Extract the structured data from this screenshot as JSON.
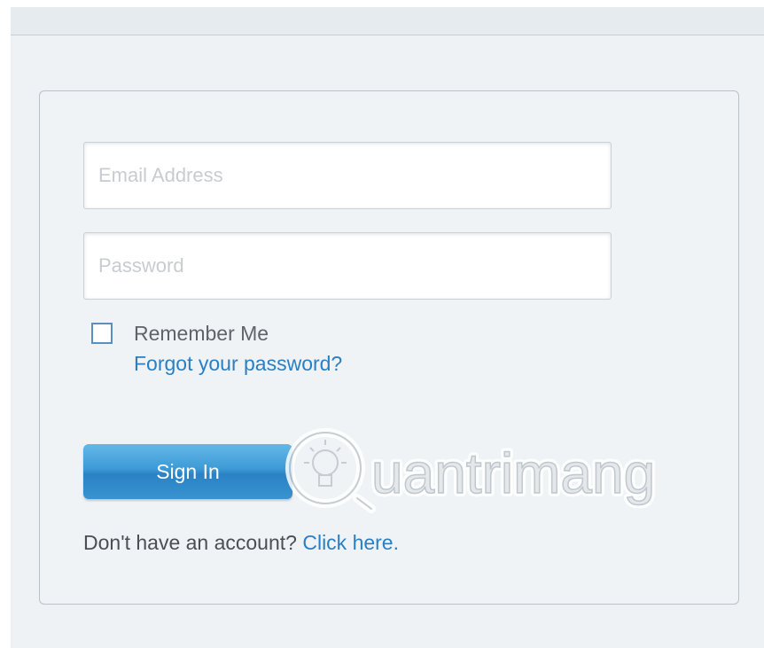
{
  "login_form": {
    "email_placeholder": "Email Address",
    "password_placeholder": "Password",
    "remember_label": "Remember Me",
    "remember_checked": false,
    "forgot_link": "Forgot your password?",
    "sign_in_label": "Sign In",
    "signup_prompt": "Don't have an account?",
    "signup_link": "Click here."
  },
  "watermark": {
    "text": "uantrimang",
    "icon": "lightbulb-icon"
  },
  "colors": {
    "link": "#2a7fc4",
    "button": "#3d9ad6",
    "background": "#eef2f5"
  }
}
